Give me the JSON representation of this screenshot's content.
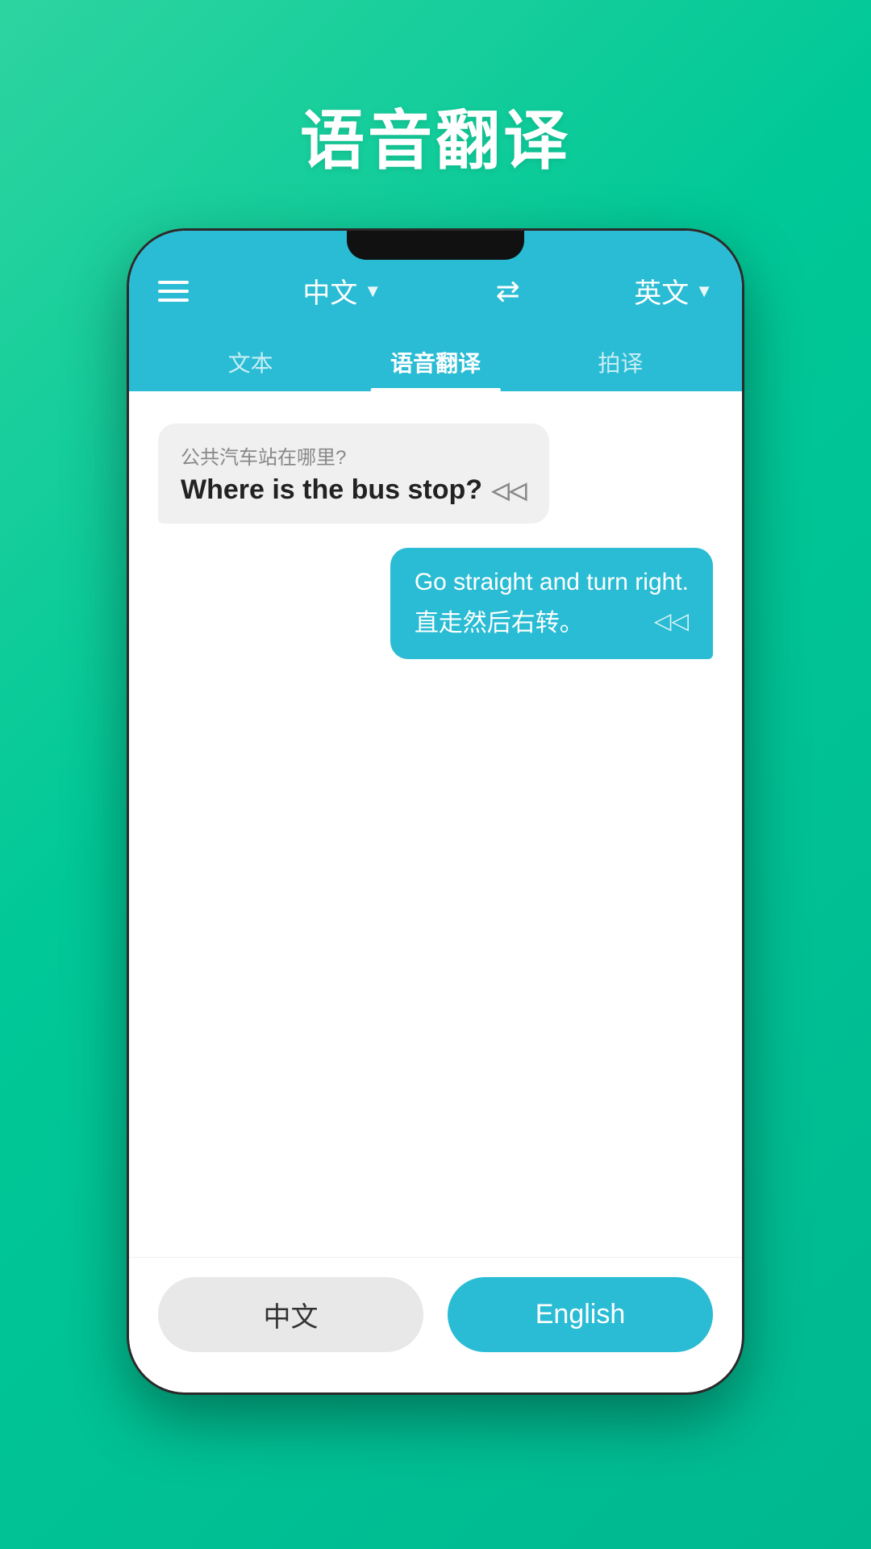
{
  "page": {
    "title": "语音翻译",
    "background_gradient_start": "#2dd4a0",
    "background_gradient_end": "#00b890"
  },
  "header": {
    "menu_icon_label": "menu",
    "source_lang": "中文",
    "source_lang_arrow": "▼",
    "swap_icon": "⇄",
    "target_lang": "英文",
    "target_lang_arrow": "▼"
  },
  "tabs": [
    {
      "id": "text",
      "label": "文本",
      "active": false
    },
    {
      "id": "voice",
      "label": "语音翻译",
      "active": true
    },
    {
      "id": "photo",
      "label": "拍译",
      "active": false
    }
  ],
  "messages": [
    {
      "id": 1,
      "side": "left",
      "subtitle": "公共汽车站在哪里?",
      "main_text": "Where is the bus stop?",
      "sound": "◁◁"
    },
    {
      "id": 2,
      "side": "right",
      "main_text": "Go straight and turn right.",
      "sub_text": "直走然后右转。",
      "sound": "◁◁"
    }
  ],
  "bottom": {
    "btn_chinese_label": "中文",
    "btn_english_label": "English"
  }
}
